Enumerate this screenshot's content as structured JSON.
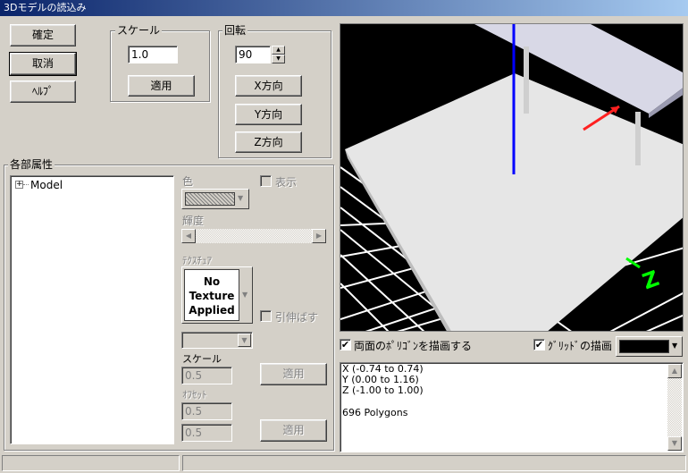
{
  "window": {
    "title": "3Dモデルの読込み"
  },
  "buttons": {
    "ok": "確定",
    "cancel": "取消",
    "help": "ﾍﾙﾌﾟ"
  },
  "scale": {
    "label": "スケール",
    "value": "1.0",
    "apply": "適用"
  },
  "rotation": {
    "label": "回転",
    "value": "90",
    "x": "X方向",
    "y": "Y方向",
    "z": "Z方向"
  },
  "parts": {
    "label": "各部属性",
    "tree": [
      {
        "expander": "+",
        "label": "Model"
      }
    ],
    "color_label": "色",
    "show_label": "表示",
    "brightness_label": "輝度",
    "texture_label": "ﾃｸｽﾁｭｱ",
    "texture_preview": "No Texture Applied",
    "stretch_label": "引伸ばす",
    "tex_scale_label": "スケール",
    "tex_scale_value": "0.5",
    "apply": "適用",
    "offset_label": "ｵﾌｾｯﾄ",
    "offset_x": "0.5",
    "offset_y": "0.5",
    "apply2": "適用"
  },
  "view_options": {
    "double_sided": "両面のﾎﾟﾘｺﾞﾝを描画する",
    "double_sided_checked": true,
    "grid": "ｸﾞﾘｯﾄﾞの描画",
    "grid_checked": true,
    "bg_color": "#000000"
  },
  "info": {
    "x_range": "X (-0.74 to 0.74)",
    "y_range": "Y (0.00 to 1.16)",
    "z_range": "Z (-1.00 to 1.00)",
    "polygons": "696 Polygons"
  },
  "viewport": {
    "axis_label": "Z"
  }
}
